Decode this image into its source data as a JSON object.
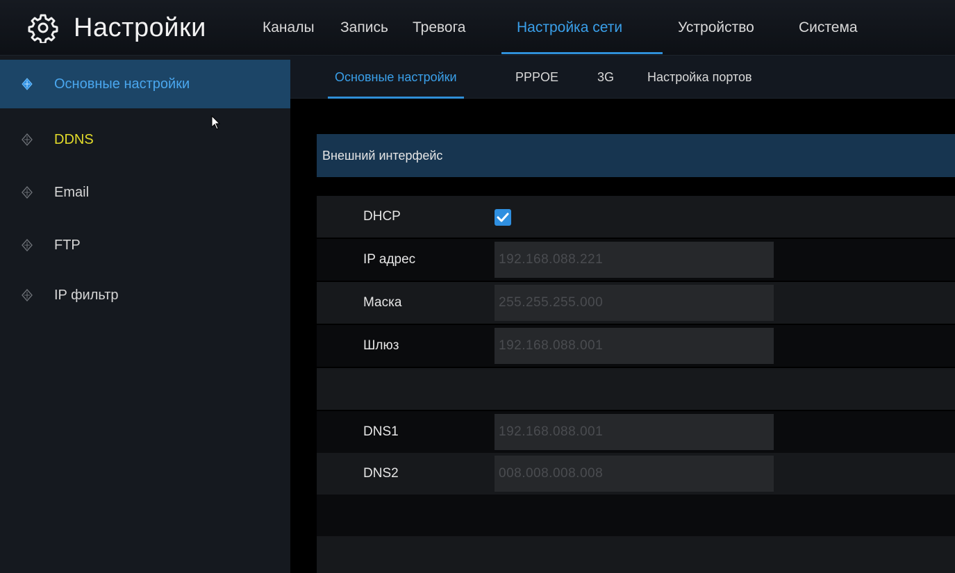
{
  "header": {
    "title": "Настройки",
    "nav": [
      {
        "label": "Каналы"
      },
      {
        "label": "Запись"
      },
      {
        "label": "Тревога"
      },
      {
        "label": "Настройка сети"
      },
      {
        "label": "Устройство"
      },
      {
        "label": "Система"
      }
    ],
    "active_nav": "Настройка сети"
  },
  "sidebar": {
    "items": [
      {
        "label": "Основные настройки"
      },
      {
        "label": "DDNS"
      },
      {
        "label": "Email"
      },
      {
        "label": "FTP"
      },
      {
        "label": "IP фильтр"
      }
    ]
  },
  "subtabs": {
    "items": [
      {
        "label": "Основные настройки"
      },
      {
        "label": "PPPOE"
      },
      {
        "label": "3G"
      },
      {
        "label": "Настройка портов"
      }
    ]
  },
  "section": {
    "title": "Внешний интерфейс"
  },
  "form": {
    "dhcp_label": "DHCP",
    "dhcp_checked": true,
    "ip_label": "IP адрес",
    "ip_value": "192.168.088.221",
    "mask_label": "Маска",
    "mask_value": "255.255.255.000",
    "gateway_label": "Шлюз",
    "gateway_value": "192.168.088.001",
    "dns1_label": "DNS1",
    "dns1_value": "192.168.088.001",
    "dns2_label": "DNS2",
    "dns2_value": "008.008.008.008"
  },
  "colors": {
    "accent": "#2f8fd8",
    "highlight_yellow": "#e3dc2a",
    "sidebar_active": "#1c4567",
    "section_head": "#173550"
  },
  "icons": {
    "header": "gear-icon",
    "sidebar": "diamond-icon",
    "checkbox": "checkmark-icon",
    "pointer": "mouse-cursor-icon"
  }
}
